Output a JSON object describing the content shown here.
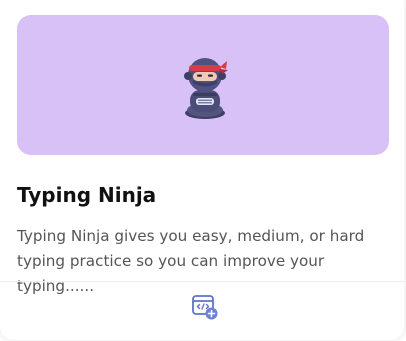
{
  "card": {
    "title": "Typing Ninja",
    "description": "Typing Ninja gives you easy, medium, or hard typing practice so you can improve your typing......",
    "banner_color": "#d8c1f6",
    "action_icon": "code-window-add-icon",
    "mascot_icon": "ninja-mascot-icon"
  }
}
